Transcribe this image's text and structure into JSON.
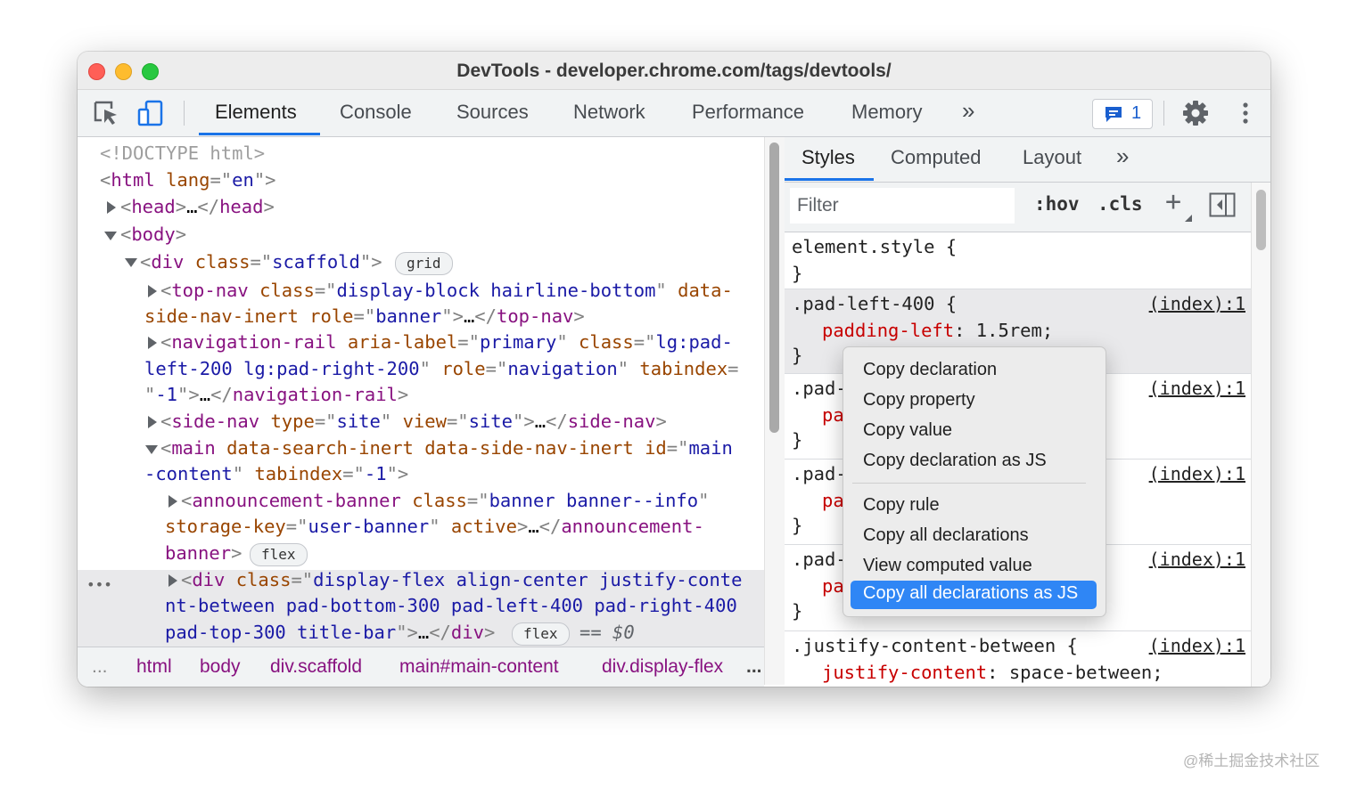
{
  "window": {
    "title": "DevTools - developer.chrome.com/tags/devtools/"
  },
  "toolbar": {
    "tabs": [
      "Elements",
      "Console",
      "Sources",
      "Network",
      "Performance",
      "Memory"
    ],
    "more_tabs": "»",
    "issues_count": "1"
  },
  "elements": {
    "doctype": "<!DOCTYPE html>",
    "html_tag": "html",
    "html_lang_attr": "lang",
    "html_lang_val": "en",
    "head_tag": "head",
    "body_tag": "body",
    "div_tag": "div",
    "class_attr": "class",
    "scaffold_val": "scaffold",
    "grid_badge": "grid",
    "topnav_tag": "top-nav",
    "topnav_class_val": "display-block hairline-bottom",
    "topnav_attr1": "data-",
    "topnav_attr1b": "side-nav-inert",
    "role_attr": "role",
    "banner_val": "banner",
    "navrail_tag": "navigation-rail",
    "aria_label_attr": "aria-label",
    "primary_val": "primary",
    "navrail_class_val1": "lg:pad-",
    "navrail_class_val2": "left-200 lg:pad-right-200",
    "navigation_val": "navigation",
    "tabindex_attr": "tabindex",
    "minus_one": "-1",
    "sidenav_tag": "side-nav",
    "type_attr": "type",
    "site_val": "site",
    "view_attr": "view",
    "main_tag": "main",
    "main_attrs": "data-search-inert data-side-nav-inert",
    "id_attr": "id",
    "main_id_val1": "main",
    "main_id_val2": "-content",
    "ann_tag": "announcement-banner",
    "ann_class_val": "banner banner--info",
    "storage_key_attr": "storage-key",
    "user_banner_val": "user-banner",
    "active_attr": "active",
    "ann_close1": "announcement-",
    "ann_close2": "banner",
    "flex_badge": "flex",
    "sel_class_val1": "display-flex align-center justify-conte",
    "sel_class_val2": "nt-between pad-bottom-300 pad-left-400 pad-right-400",
    "sel_class_val3": "pad-top-300 title-bar",
    "eq_dollar": "== $0",
    "ellipsis": "…",
    "row_dots": "•••"
  },
  "breadcrumbs": {
    "leading": "...",
    "items": [
      "html",
      "body",
      "div.scaffold",
      "main#main-content",
      "div.display-flex"
    ],
    "trailing": "..."
  },
  "styles": {
    "tabs": [
      "Styles",
      "Computed",
      "Layout"
    ],
    "more_tabs": "»",
    "filter_placeholder": "Filter",
    "hov": ":hov",
    "cls": ".cls",
    "plus": "+",
    "element_style": "element.style {",
    "close_brace": "}",
    "rules": [
      {
        "selector": ".pad-left-400 {",
        "prop": "padding-left",
        "value": "1.5rem;",
        "source": "(index):1"
      },
      {
        "selector": ".pad-",
        "prop": "pa",
        "source": "(index):1"
      },
      {
        "selector": ".pad-",
        "prop": "pa",
        "source": "(index):1"
      },
      {
        "selector": ".pad-",
        "prop": "pa",
        "source": "(index):1"
      },
      {
        "selector": ".justify-content-between {",
        "prop": "justify-content",
        "value": "space-between;",
        "source": "(index):1"
      }
    ]
  },
  "context_menu": {
    "group1": [
      "Copy declaration",
      "Copy property",
      "Copy value",
      "Copy declaration as JS"
    ],
    "group2": [
      "Copy rule",
      "Copy all declarations",
      "View computed value"
    ],
    "active_item": "Copy all declarations as JS"
  },
  "watermark": "@稀土掘金技术社区"
}
